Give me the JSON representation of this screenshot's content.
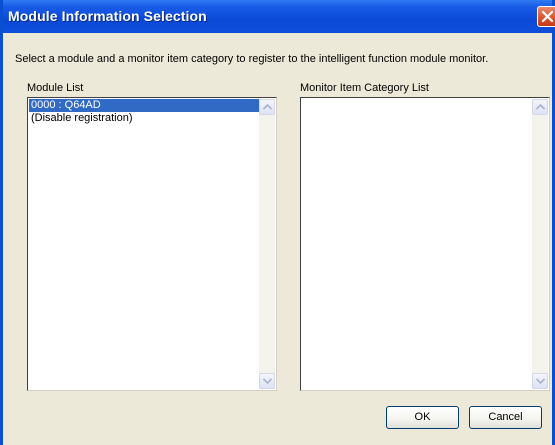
{
  "window": {
    "title": "Module Information Selection"
  },
  "instruction": "Select a module and a monitor item category to register to the intelligent function module monitor.",
  "module_list": {
    "label": "Module List",
    "items": [
      {
        "text": "0000 : Q64AD",
        "selected": true
      },
      {
        "text": "(Disable registration)",
        "selected": false
      }
    ]
  },
  "monitor_list": {
    "label": "Monitor Item Category List",
    "items": []
  },
  "buttons": {
    "ok": "OK",
    "cancel": "Cancel"
  },
  "icons": {
    "close": "close-icon",
    "scroll_up": "scroll-up-arrow-icon",
    "scroll_down": "scroll-down-arrow-icon"
  },
  "colors": {
    "titlebar": "#0a49d8",
    "selection": "#316ac5",
    "dialog_bg": "#ece9d8",
    "close_button": "#d8532c"
  }
}
